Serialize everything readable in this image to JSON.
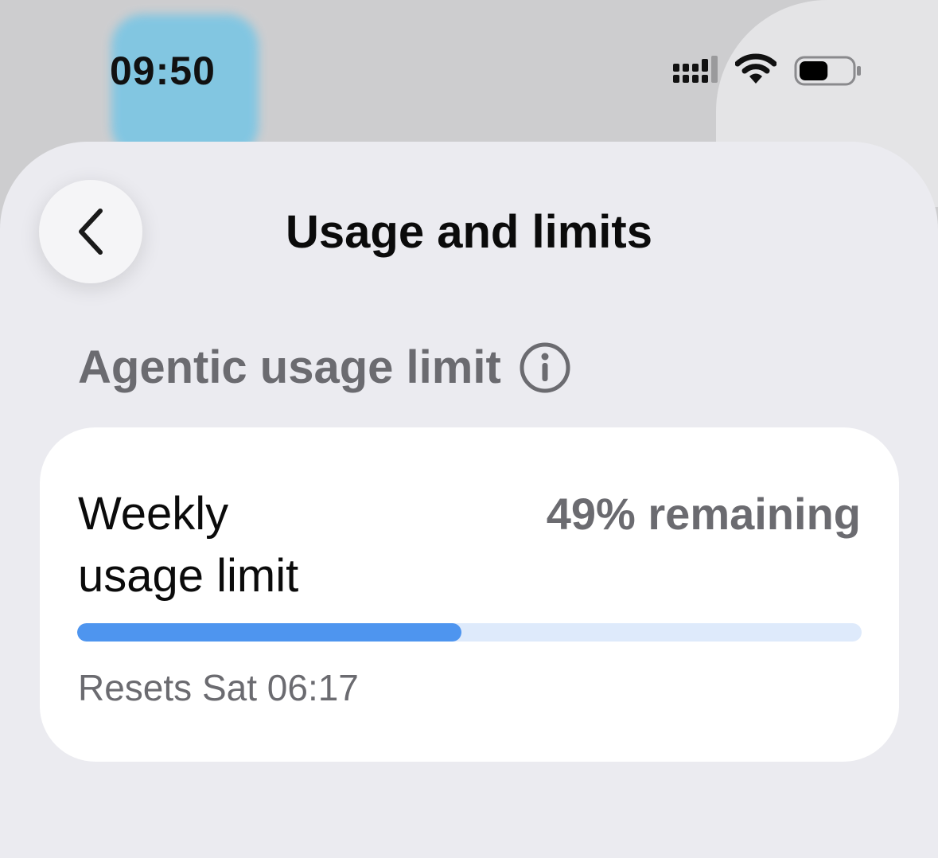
{
  "status_bar": {
    "time": "09:50",
    "signal_icon": "cellular-signal-icon",
    "wifi_icon": "wifi-icon",
    "battery_icon": "battery-icon",
    "battery_level": 0.55
  },
  "header": {
    "title": "Usage and limits",
    "back_icon": "chevron-left-icon"
  },
  "section": {
    "title": "Agentic usage limit",
    "info_icon": "info-icon"
  },
  "card": {
    "label": "Weekly usage limit",
    "remaining": "49% remaining",
    "used_fraction": 0.49,
    "reset": "Resets Sat 06:17"
  },
  "colors": {
    "accent": "#4e95ef",
    "track": "#deeafb",
    "secondary_text": "#6b6b70"
  }
}
